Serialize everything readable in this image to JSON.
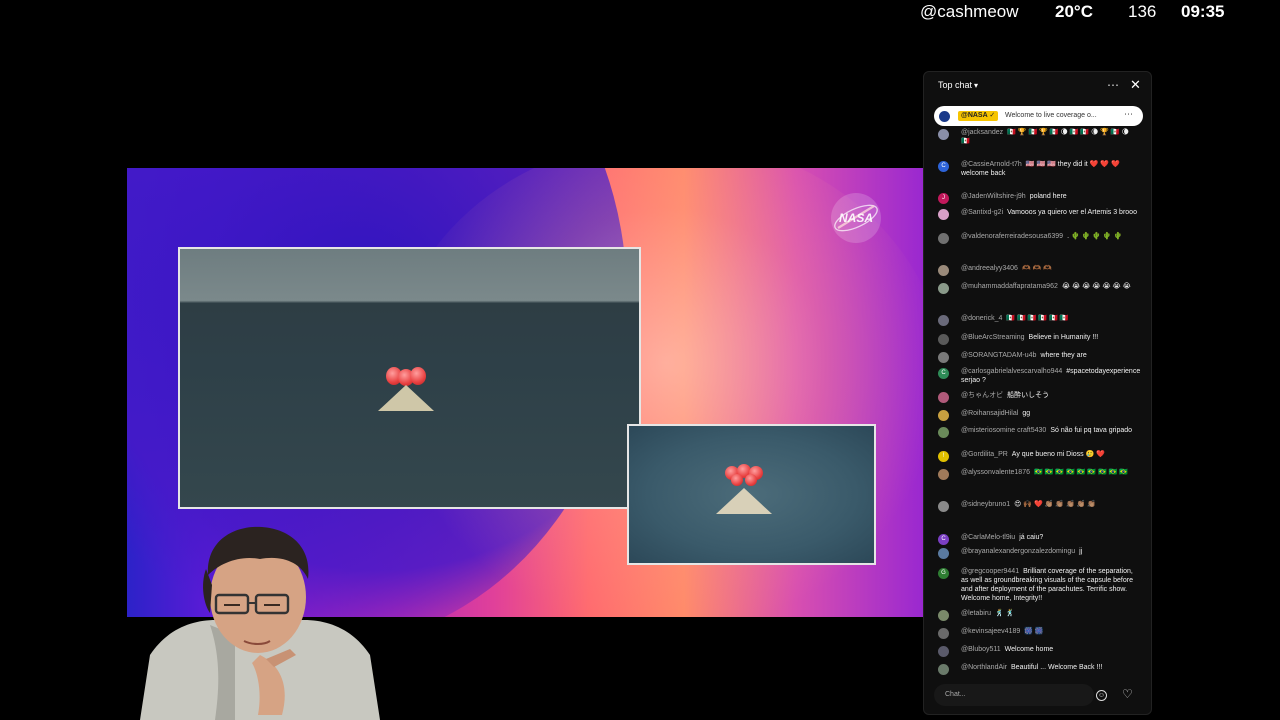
{
  "status": {
    "user": "@cashmeow",
    "temperature": "20°C",
    "count": "136",
    "time": "09:35"
  },
  "chat": {
    "title": "Top chat",
    "pinned": {
      "badge": "@NASA ✓",
      "message": "Welcome to live coverage o..."
    },
    "input_placeholder": "Chat...",
    "messages": [
      {
        "author": "@jacksandez",
        "text": "🇲🇽 🏆 🇲🇽 🏆 🇲🇽 🌘 🇲🇽 🇲🇽 🌘 🏆 🇲🇽 🌘 🇲🇽",
        "avatar": "",
        "color": "#8a8fa8"
      },
      {
        "author": "@CassieArnold-t7h",
        "text": "🇺🇸 🇺🇸 🇺🇸 they did it ❤️ ❤️ ❤️ welcome back",
        "avatar": "C",
        "color": "#2d63d8"
      },
      {
        "author": "@JadenWiltshire-j9h",
        "text": "poland here",
        "avatar": "J",
        "color": "#c2185b"
      },
      {
        "author": "@Santixd-g2i",
        "text": "Vamooos ya quiero ver el Artemis 3 brooo",
        "avatar": "",
        "color": "#d8a0c8"
      },
      {
        "author": "@valdenoraferreiradesousa6399",
        "text": ". 🌵 🌵 🌵 🌵 🌵",
        "avatar": "",
        "color": "#707070"
      },
      {
        "author": "@andreealyy3406",
        "text": "🫶🏾 🫶🏾 🫶🏾",
        "avatar": "",
        "color": "#9a8a7a"
      },
      {
        "author": "@muhammaddaffapratama962",
        "text": "😭 😭 😭 😭 😭 😭 😭",
        "avatar": "",
        "color": "#8a9a8a"
      },
      {
        "author": "@donerick_4",
        "text": "🇲🇽 🇲🇽 🇲🇽 🇲🇽 🇲🇽 🇲🇽",
        "avatar": "",
        "color": "#6a6a7a"
      },
      {
        "author": "@BlueArcStreaming",
        "text": "Believe in Humanity !!!",
        "avatar": "",
        "color": "#5a5a5a"
      },
      {
        "author": "@SORANGTADAM-u4b",
        "text": "where they are",
        "avatar": "",
        "color": "#7a7a7a"
      },
      {
        "author": "@carlosgabrielalvescarvalho944",
        "text": "#spacetodayexperience serjao ?",
        "avatar": "C",
        "color": "#2e8b57"
      },
      {
        "author": "@ちゃんオビ",
        "text": "船酔いしそう",
        "avatar": "",
        "color": "#b05a7a"
      },
      {
        "author": "@RoihansajidHilal",
        "text": "gg",
        "avatar": "",
        "color": "#c8a040"
      },
      {
        "author": "@misteriosomine craft5430",
        "text": "Só não fui pq tava gripado",
        "avatar": "",
        "color": "#6a8a5a"
      },
      {
        "author": "@Gordilita_PR",
        "text": "Ay que bueno mi Dioss 🥲 ❤️",
        "avatar": "!",
        "color": "#e0c000"
      },
      {
        "author": "@alyssonvalente1876",
        "text": "🇧🇷 🇧🇷 🇧🇷 🇧🇷 🇧🇷 🇧🇷 🇧🇷 🇧🇷 🇧🇷",
        "avatar": "",
        "color": "#a07a5a"
      },
      {
        "author": "@sidneybruno1",
        "text": "😍 🙌🏾 ❤️ 👏🏽 👏🏽 👏🏽 👏🏽 👏🏽",
        "avatar": "",
        "color": "#8a8a8a"
      },
      {
        "author": "@CarlaMelo-tl9iu",
        "text": "já caiu?",
        "avatar": "C",
        "color": "#7b3fc4"
      },
      {
        "author": "@brayanalexandergonzalezdomingu",
        "text": "jj",
        "avatar": "",
        "color": "#5a7aa0"
      },
      {
        "author": "@gregcooper9441",
        "text": "Brilliant coverage of the separation, as well as groundbreaking visuals of the capsule before and after deployment of the parachutes. Terrific show. Welcome home, Integrity!!",
        "avatar": "G",
        "color": "#2e7d32"
      },
      {
        "author": "@letabiru",
        "text": "🕺 🕺",
        "avatar": "",
        "color": "#7a8a6a"
      },
      {
        "author": "@kevinsajeev4189",
        "text": "🎆 🎆",
        "avatar": "",
        "color": "#6a6a6a"
      },
      {
        "author": "@Bluboy511",
        "text": "Welcome home",
        "avatar": "",
        "color": "#5a5a6a"
      },
      {
        "author": "@NorthlandAir",
        "text": "Beautiful ... Welcome Back !!!",
        "avatar": "",
        "color": "#6a7a6a"
      }
    ]
  },
  "icons": {
    "more": "more-vertical-icon",
    "close": "close-icon",
    "emoji": "emoji-icon",
    "like": "heart-icon"
  },
  "stream": {
    "logo_text": "NASA"
  }
}
